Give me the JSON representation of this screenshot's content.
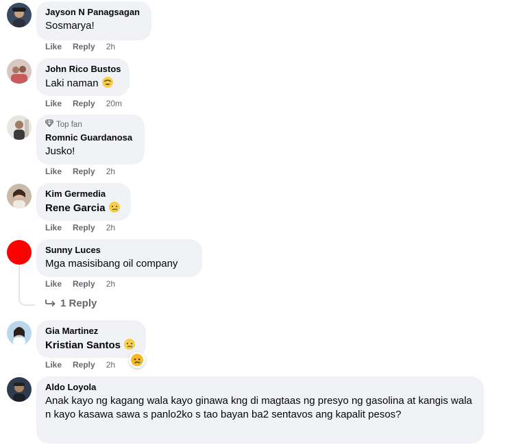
{
  "comments": [
    {
      "name": "Jayson N Panagsagan",
      "text": "Sosmarya!",
      "like": "Like",
      "reply": "Reply",
      "time": "2h"
    },
    {
      "name": "John Rico Bustos",
      "text": "Laki naman",
      "like": "Like",
      "reply": "Reply",
      "time": "20m"
    },
    {
      "badge": "Top fan",
      "name": "Romnic Guardanosa",
      "text": "Jusko!",
      "like": "Like",
      "reply": "Reply",
      "time": "2h"
    },
    {
      "name": "Kim Germedia",
      "text": "Rene Garcia",
      "like": "Like",
      "reply": "Reply",
      "time": "2h"
    },
    {
      "name": "Sunny Luces",
      "text": "Mga masisibang oil company",
      "like": "Like",
      "reply": "Reply",
      "time": "2h"
    },
    {
      "name": "Gia Martinez",
      "text": "Kristian Santos",
      "like": "Like",
      "reply": "Reply",
      "time": "2h"
    },
    {
      "name": "Aldo Loyola",
      "text": "Anak kayo ng kagang wala kayo ginawa kng di magtaas ng presyo ng gasolina at kangis wala n kayo kasawa sawa s panlo2ko s tao bayan ba2 sentavos ang kapalit pesos?"
    }
  ],
  "view_replies": "1 Reply",
  "colors": {
    "bubble": "#f0f2f5",
    "muted": "#65676b",
    "red_avatar": "#ff0000"
  },
  "icons": [
    "diamond-icon",
    "reply-arrow-icon",
    "laughing-emoji-icon",
    "crying-emoji-icon",
    "sad-reaction-icon"
  ]
}
